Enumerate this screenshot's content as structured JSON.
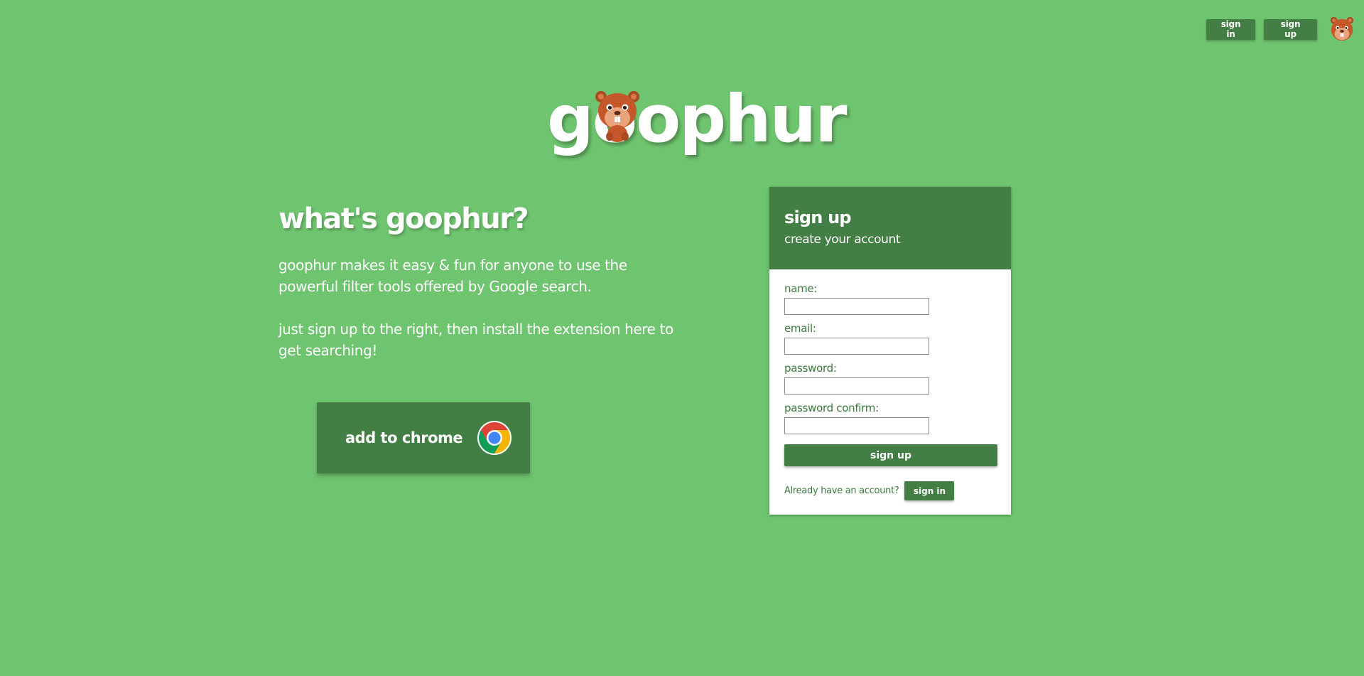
{
  "nav": {
    "sign_in_label": "sign in",
    "sign_up_label": "sign up"
  },
  "logo": {
    "text": "goophur"
  },
  "info": {
    "title": "what's goophur?",
    "paragraph1": "goophur makes it easy & fun for anyone to use the powerful filter tools offered by Google search.",
    "paragraph2": "just sign up to the right, then install the extension here to get searching!"
  },
  "chrome_button": {
    "label": "add to chrome"
  },
  "signup_card": {
    "title": "sign up",
    "subtitle": "create your account",
    "fields": [
      {
        "label": "name:",
        "value": ""
      },
      {
        "label": "email:",
        "value": ""
      },
      {
        "label": "password:",
        "value": ""
      },
      {
        "label": "password confirm:",
        "value": ""
      }
    ],
    "submit_label": "sign up",
    "account_prompt": "Already have an account?",
    "sign_in_label": "sign in"
  },
  "colors": {
    "background": "#6fc46f",
    "primary_dark": "#437e44",
    "text_green": "#3b7a3c",
    "white": "#ffffff"
  },
  "icons": {
    "nav_avatar": "beaver-mascot-icon",
    "logo_mascot": "beaver-mascot-icon",
    "chrome": "chrome-logo-icon"
  }
}
